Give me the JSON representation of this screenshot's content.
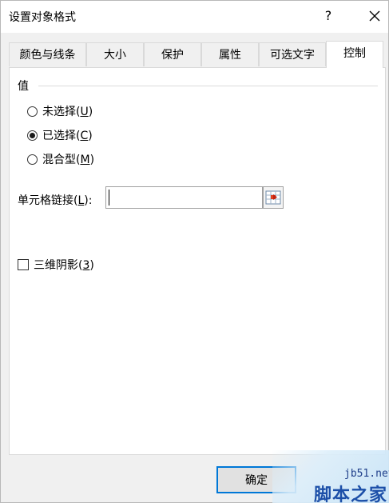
{
  "window": {
    "title": "设置对象格式",
    "help_label": "?"
  },
  "tabs": [
    {
      "label": "颜色与线条",
      "active": false
    },
    {
      "label": "大小",
      "active": false
    },
    {
      "label": "保护",
      "active": false
    },
    {
      "label": "属性",
      "active": false
    },
    {
      "label": "可选文字",
      "active": false
    },
    {
      "label": "控制",
      "active": true
    }
  ],
  "value_group": {
    "label": "值",
    "options": [
      {
        "text": "未选择(",
        "key": "U",
        "suffix": ")",
        "checked": false
      },
      {
        "text": "已选择(",
        "key": "C",
        "suffix": ")",
        "checked": true
      },
      {
        "text": "混合型(",
        "key": "M",
        "suffix": ")",
        "checked": false
      }
    ]
  },
  "cell_link": {
    "label_text": "单元格链接(",
    "label_key": "L",
    "label_suffix": "):",
    "value": ""
  },
  "shading": {
    "text": "三维阴影(",
    "key": "3",
    "suffix": ")",
    "checked": false
  },
  "buttons": {
    "ok": "确定"
  },
  "watermark": {
    "url": "jb51.net",
    "text": "脚本之家"
  },
  "colors": {
    "accent": "#0078d7",
    "watermark": "#1c4fa8"
  }
}
